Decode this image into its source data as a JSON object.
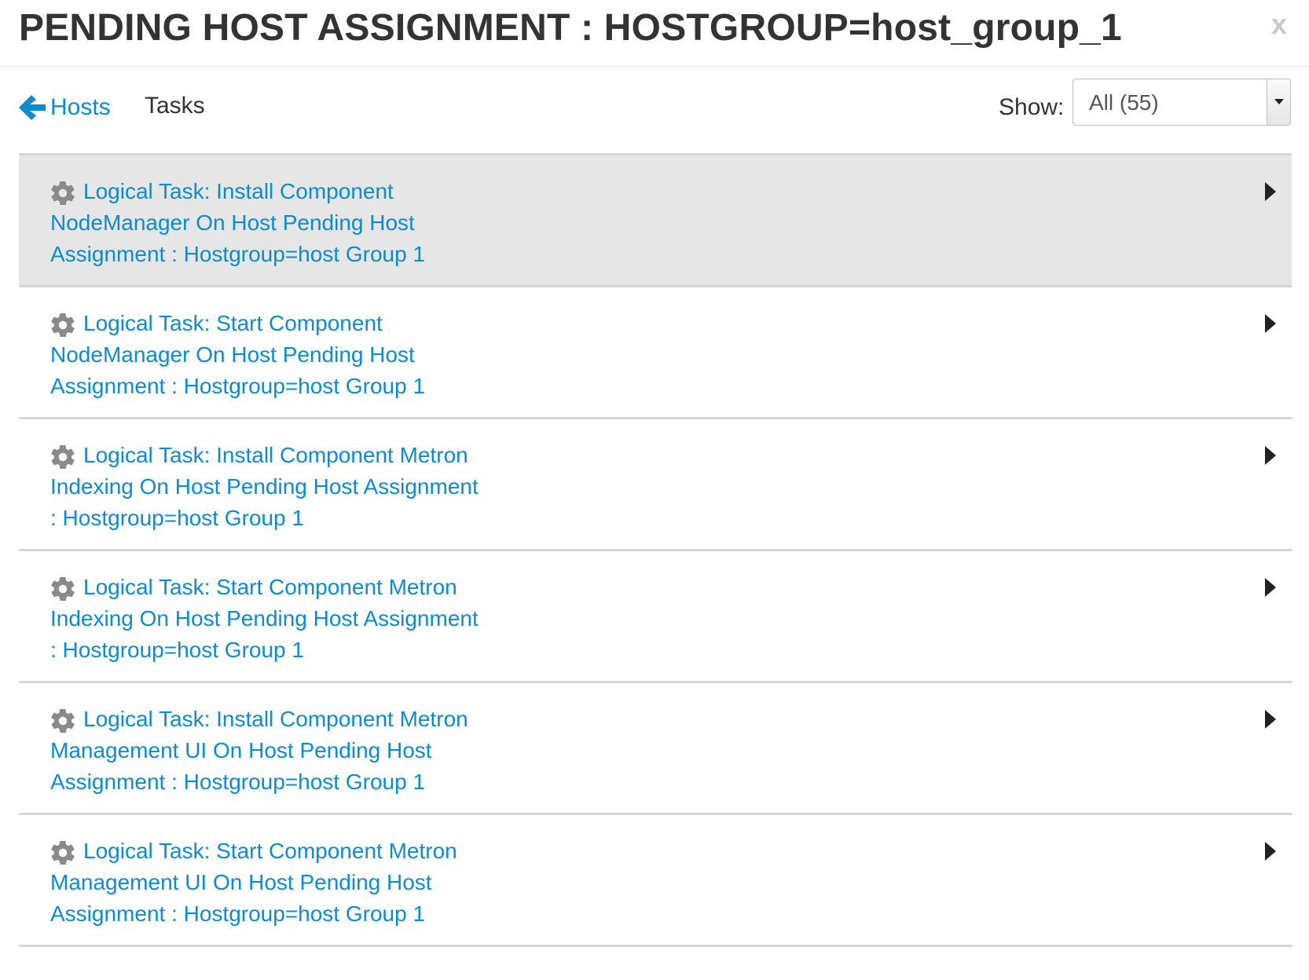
{
  "modal": {
    "title": "PENDING HOST ASSIGNMENT : HOSTGROUP=host_group_1",
    "close_label": "x"
  },
  "nav": {
    "back_icon": "arrow-left-icon",
    "back_label": "Hosts",
    "current_label": "Tasks"
  },
  "filter": {
    "label": "Show:",
    "selected": "All (55)"
  },
  "colors": {
    "link": "#0c8ccf",
    "highlight_row": "#e6e6e6",
    "gear": "#8a8a8a"
  },
  "tasks": [
    {
      "icon": "gear-icon",
      "text": "Logical Task: Install Component NodeManager On Host Pending Host Assignment : Hostgroup=host Group 1",
      "highlighted": true
    },
    {
      "icon": "gear-icon",
      "text": "Logical Task: Start Component NodeManager On Host Pending Host Assignment : Hostgroup=host Group 1",
      "highlighted": false
    },
    {
      "icon": "gear-icon",
      "text": "Logical Task: Install Component Metron Indexing On Host Pending Host Assignment : Hostgroup=host Group 1",
      "highlighted": false
    },
    {
      "icon": "gear-icon",
      "text": "Logical Task: Start Component Metron Indexing On Host Pending Host Assignment : Hostgroup=host Group 1",
      "highlighted": false
    },
    {
      "icon": "gear-icon",
      "text": "Logical Task: Install Component Metron Management UI On Host Pending Host Assignment : Hostgroup=host Group 1",
      "highlighted": false
    },
    {
      "icon": "gear-icon",
      "text": "Logical Task: Start Component Metron Management UI On Host Pending Host Assignment : Hostgroup=host Group 1",
      "highlighted": false
    }
  ]
}
